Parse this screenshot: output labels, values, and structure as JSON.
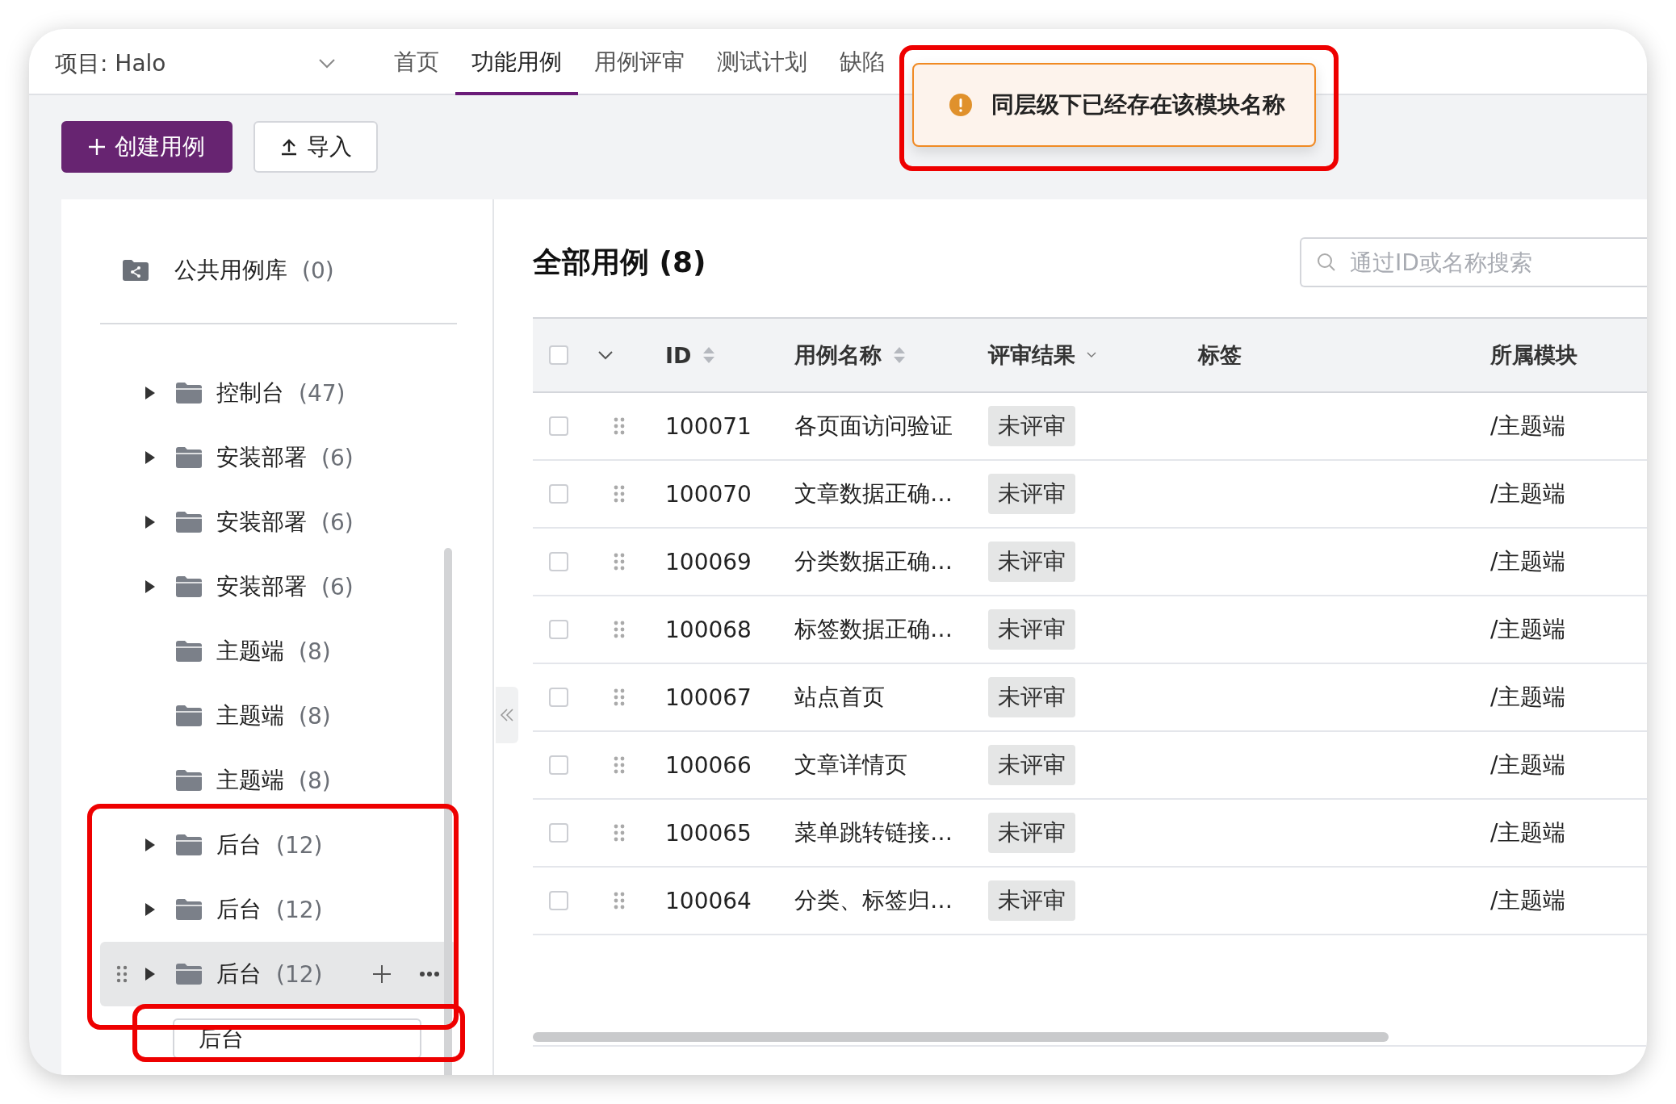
{
  "header": {
    "project": "项目: Halo",
    "nav": [
      {
        "label": "首页",
        "selected": false
      },
      {
        "label": "功能用例",
        "selected": true
      },
      {
        "label": "用例评审",
        "selected": false
      },
      {
        "label": "测试计划",
        "selected": false
      },
      {
        "label": "缺陷",
        "selected": false
      }
    ]
  },
  "toolbar": {
    "create_button": "创建用例",
    "import_button": "导入"
  },
  "toast": {
    "kind": "warning",
    "message": "同层级下已经存在该模块名称"
  },
  "sidebar": {
    "public_library": {
      "label": "公共用例库",
      "count": "(0)"
    },
    "items": [
      {
        "label": "控制台",
        "count": "(47)",
        "expandable": true,
        "selected": false
      },
      {
        "label": "安装部署",
        "count": "(6)",
        "expandable": true,
        "selected": false
      },
      {
        "label": "安装部署",
        "count": "(6)",
        "expandable": true,
        "selected": false
      },
      {
        "label": "安装部署",
        "count": "(6)",
        "expandable": true,
        "selected": false
      },
      {
        "label": "主题端",
        "count": "(8)",
        "expandable": false,
        "selected": false
      },
      {
        "label": "主题端",
        "count": "(8)",
        "expandable": false,
        "selected": false
      },
      {
        "label": "主题端",
        "count": "(8)",
        "expandable": false,
        "selected": false
      },
      {
        "label": "后台",
        "count": "(12)",
        "expandable": true,
        "selected": false
      },
      {
        "label": "后台",
        "count": "(12)",
        "expandable": true,
        "selected": false
      },
      {
        "label": "后台",
        "count": "(12)",
        "expandable": true,
        "selected": true
      }
    ],
    "new_module_input": {
      "value": "后台"
    }
  },
  "main": {
    "title": "全部用例 (8)",
    "search": {
      "placeholder": "通过ID或名称搜索"
    },
    "table": {
      "header_checked": false,
      "columns": [
        "ID",
        "用例名称",
        "评审结果",
        "标签",
        "所属模块"
      ],
      "rows": [
        {
          "checked": false,
          "id": "100071",
          "name": "各页面访问验证",
          "review": "未评审",
          "module": "/主题端"
        },
        {
          "checked": false,
          "id": "100070",
          "name": "文章数据正确…",
          "review": "未评审",
          "module": "/主题端"
        },
        {
          "checked": false,
          "id": "100069",
          "name": "分类数据正确…",
          "review": "未评审",
          "module": "/主题端"
        },
        {
          "checked": false,
          "id": "100068",
          "name": "标签数据正确…",
          "review": "未评审",
          "module": "/主题端"
        },
        {
          "checked": false,
          "id": "100067",
          "name": "站点首页",
          "review": "未评审",
          "module": "/主题端"
        },
        {
          "checked": false,
          "id": "100066",
          "name": "文章详情页",
          "review": "未评审",
          "module": "/主题端"
        },
        {
          "checked": false,
          "id": "100065",
          "name": "菜单跳转链接…",
          "review": "未评审",
          "module": "/主题端"
        },
        {
          "checked": false,
          "id": "100064",
          "name": "分类、标签归…",
          "review": "未评审",
          "module": "/主题端"
        }
      ]
    }
  }
}
